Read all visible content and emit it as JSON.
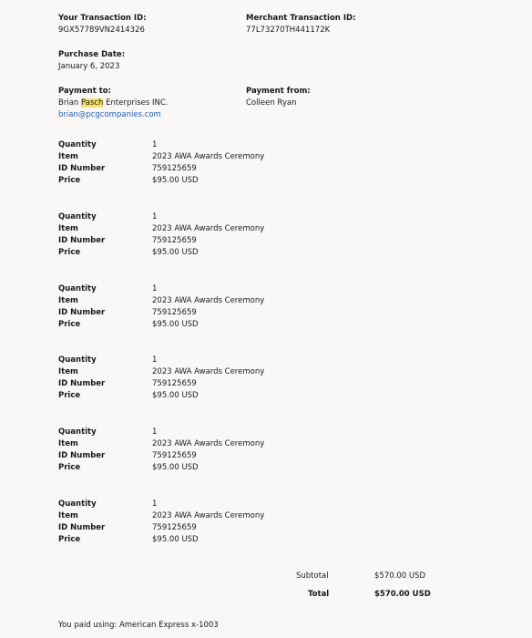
{
  "header": {
    "transaction_id_label": "Your Transaction ID:",
    "transaction_id_value": "9GX57789VN2414326",
    "merchant_id_label": "Merchant Transaction ID:",
    "merchant_id_value": "77L73270TH441172K",
    "purchase_date_label": "Purchase Date:",
    "purchase_date_value": "January 6, 2023",
    "payment_to_label": "Payment to:",
    "payment_to_name_pre": "Brian ",
    "payment_to_name_hl": "Pasch",
    "payment_to_name_post": " Enterprises INC.",
    "payment_to_email": "brian@pcgcompanies.com",
    "payment_from_label": "Payment from:",
    "payment_from_name": "Colleen Ryan"
  },
  "line_labels": {
    "quantity": "Quantity",
    "item": "Item",
    "id_number": "ID Number",
    "price": "Price"
  },
  "items": [
    {
      "quantity": "1",
      "item": "2023 AWA Awards Ceremony",
      "id_number": "759125659",
      "price": "$95.00 USD"
    },
    {
      "quantity": "1",
      "item": "2023 AWA Awards Ceremony",
      "id_number": "759125659",
      "price": "$95.00 USD"
    },
    {
      "quantity": "1",
      "item": "2023 AWA Awards Ceremony",
      "id_number": "759125659",
      "price": "$95.00 USD"
    },
    {
      "quantity": "1",
      "item": "2023 AWA Awards Ceremony",
      "id_number": "759125659",
      "price": "$95.00 USD"
    },
    {
      "quantity": "1",
      "item": "2023 AWA Awards Ceremony",
      "id_number": "759125659",
      "price": "$95.00 USD"
    },
    {
      "quantity": "1",
      "item": "2023 AWA Awards Ceremony",
      "id_number": "759125659",
      "price": "$95.00 USD"
    }
  ],
  "totals": {
    "subtotal_label": "Subtotal",
    "subtotal_value": "$570.00 USD",
    "total_label": "Total",
    "total_value": "$570.00 USD"
  },
  "footer": {
    "paid_using": "You paid using: American Express x-1003"
  },
  "colors": {
    "background": "#f9f8f6",
    "highlight": "#fbe36b",
    "link": "#1f5fbf"
  }
}
